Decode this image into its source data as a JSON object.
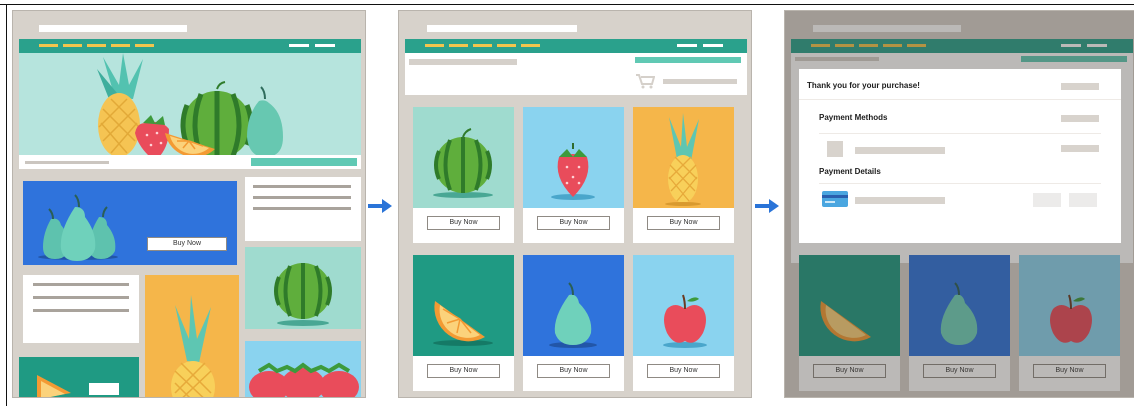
{
  "buy_label": "Buy Now",
  "checkout": {
    "thanks": "Thank you for your purchase!",
    "payment_methods": "Payment Methods",
    "payment_details": "Payment Details"
  },
  "colors": {
    "nav": "#2aa18c",
    "nav_links": "#f3c54d",
    "accent_teal": "#60c9b4",
    "arrow": "#2a74d8"
  }
}
